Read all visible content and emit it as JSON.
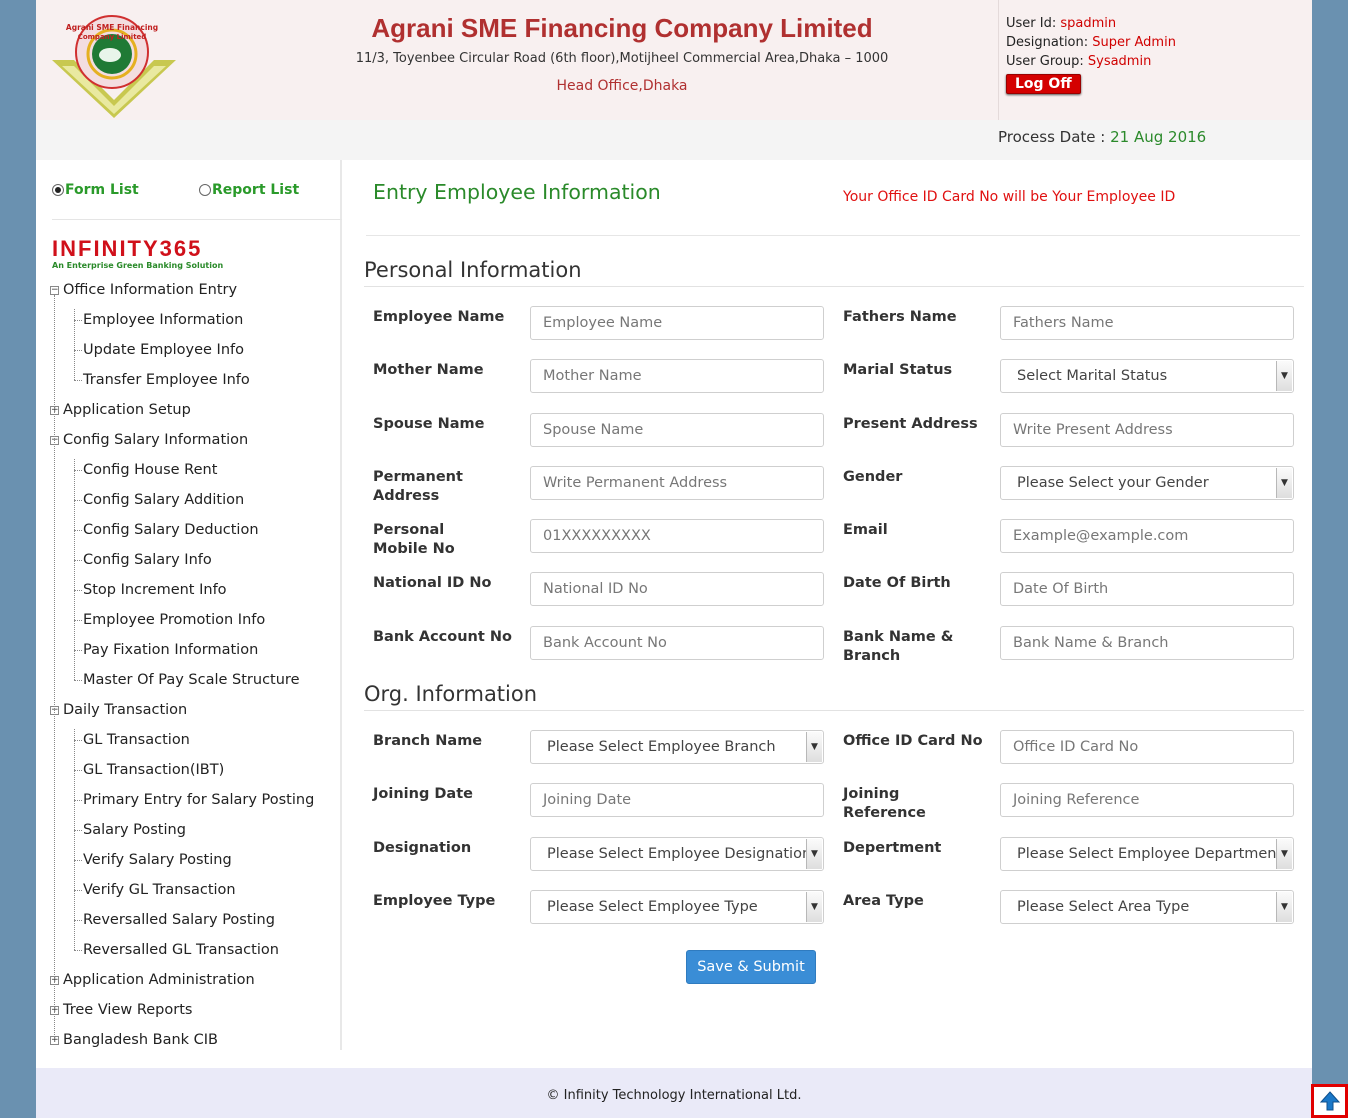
{
  "header": {
    "company_name": "Agrani SME Financing Company Limited",
    "address": "11/3, Toyenbee Circular Road (6th floor),Motijheel Commercial Area,Dhaka – 1000",
    "head_office": "Head Office,Dhaka",
    "logo_text": "Agrani SME Financing Company Limited"
  },
  "user": {
    "user_id_label": "User Id:",
    "user_id": "spadmin",
    "designation_label": "Designation:",
    "designation": "Super Admin",
    "group_label": "User Group:",
    "group": "Sysadmin",
    "logoff_label": "Log Off"
  },
  "process": {
    "label": "Process Date :",
    "date": "21 Aug 2016"
  },
  "sidebar": {
    "tabs": [
      {
        "label": "Form List",
        "selected": true
      },
      {
        "label": "Report List",
        "selected": false
      }
    ],
    "brand": {
      "word": "INFINITY365",
      "tagline": "An Enterprise Green Banking Solution"
    },
    "tree": [
      {
        "label": "Office Information Entry",
        "level": 1,
        "expander": "−"
      },
      {
        "label": "Employee Information",
        "level": 2
      },
      {
        "label": "Update Employee Info",
        "level": 2
      },
      {
        "label": "Transfer Employee Info",
        "level": 2
      },
      {
        "label": "Application Setup",
        "level": 1,
        "expander": "+"
      },
      {
        "label": "Config Salary Information",
        "level": 1,
        "expander": "−"
      },
      {
        "label": "Config House Rent",
        "level": 2
      },
      {
        "label": "Config Salary Addition",
        "level": 2
      },
      {
        "label": "Config Salary Deduction",
        "level": 2
      },
      {
        "label": "Config Salary Info",
        "level": 2
      },
      {
        "label": "Stop Increment Info",
        "level": 2
      },
      {
        "label": "Employee Promotion Info",
        "level": 2
      },
      {
        "label": "Pay Fixation Information",
        "level": 2
      },
      {
        "label": "Master Of Pay Scale Structure",
        "level": 2
      },
      {
        "label": "Daily Transaction",
        "level": 1,
        "expander": "−"
      },
      {
        "label": "GL Transaction",
        "level": 2
      },
      {
        "label": "GL Transaction(IBT)",
        "level": 2
      },
      {
        "label": "Primary Entry for Salary Posting",
        "level": 2
      },
      {
        "label": "Salary Posting",
        "level": 2
      },
      {
        "label": "Verify Salary Posting",
        "level": 2
      },
      {
        "label": "Verify GL Transaction",
        "level": 2
      },
      {
        "label": "Reversalled Salary Posting",
        "level": 2
      },
      {
        "label": "Reversalled GL Transaction",
        "level": 2
      },
      {
        "label": "Application Administration",
        "level": 1,
        "expander": "+"
      },
      {
        "label": "Tree View Reports",
        "level": 1,
        "expander": "+"
      },
      {
        "label": "Bangladesh Bank CIB",
        "level": 1,
        "expander": "+"
      }
    ]
  },
  "main": {
    "title": "Entry Employee Information",
    "note": "Your Office ID Card No will be Your Employee ID",
    "personal_section": "Personal Information",
    "org_section": "Org. Information",
    "fields": {
      "employee_name": {
        "label": "Employee Name",
        "placeholder": "Employee Name"
      },
      "fathers_name": {
        "label": "Fathers Name",
        "placeholder": "Fathers Name"
      },
      "mother_name": {
        "label": "Mother Name",
        "placeholder": "Mother Name"
      },
      "marital_status": {
        "label": "Marial Status",
        "value": "Select Marital Status"
      },
      "spouse_name": {
        "label": "Spouse Name",
        "placeholder": "Spouse Name"
      },
      "present_address": {
        "label": "Present Address",
        "placeholder": "Write Present Address"
      },
      "permanent_address": {
        "label": "Permanent Address",
        "placeholder": "Write Permanent Address"
      },
      "gender": {
        "label": "Gender",
        "value": "Please Select your Gender"
      },
      "mobile": {
        "label": "Personal Mobile No",
        "placeholder": "01XXXXXXXXX"
      },
      "email": {
        "label": "Email",
        "placeholder": "Example@example.com"
      },
      "national_id": {
        "label": "National ID No",
        "placeholder": "National ID No"
      },
      "dob": {
        "label": "Date Of Birth",
        "placeholder": "Date Of Birth"
      },
      "bank_account": {
        "label": "Bank Account No",
        "placeholder": "Bank Account No"
      },
      "bank_name": {
        "label": "Bank Name & Branch",
        "placeholder": "Bank Name & Branch"
      },
      "branch_name": {
        "label": "Branch Name",
        "value": "Please Select Employee Branch"
      },
      "office_id": {
        "label": "Office ID Card No",
        "placeholder": "Office ID Card No"
      },
      "joining_date": {
        "label": "Joining Date",
        "placeholder": "Joining Date"
      },
      "joining_ref": {
        "label": "Joining Reference",
        "placeholder": "Joining Reference"
      },
      "designation": {
        "label": "Designation",
        "value": "Please Select Employee Designation"
      },
      "department": {
        "label": "Depertment",
        "value": "Please Select Employee Department"
      },
      "employee_type": {
        "label": "Employee Type",
        "value": "Please Select Employee Type"
      },
      "area_type": {
        "label": "Area Type",
        "value": "Please Select Area Type"
      }
    },
    "submit_label": "Save & Submit"
  },
  "footer": {
    "text": "© Infinity Technology International Ltd."
  },
  "icons": {
    "scroll_top": "arrow-up-icon"
  },
  "colors": {
    "brand_red": "#b03030",
    "green": "#2a8a2a",
    "button_blue": "#3a8dd6",
    "frame_blue": "#6a91b0"
  }
}
